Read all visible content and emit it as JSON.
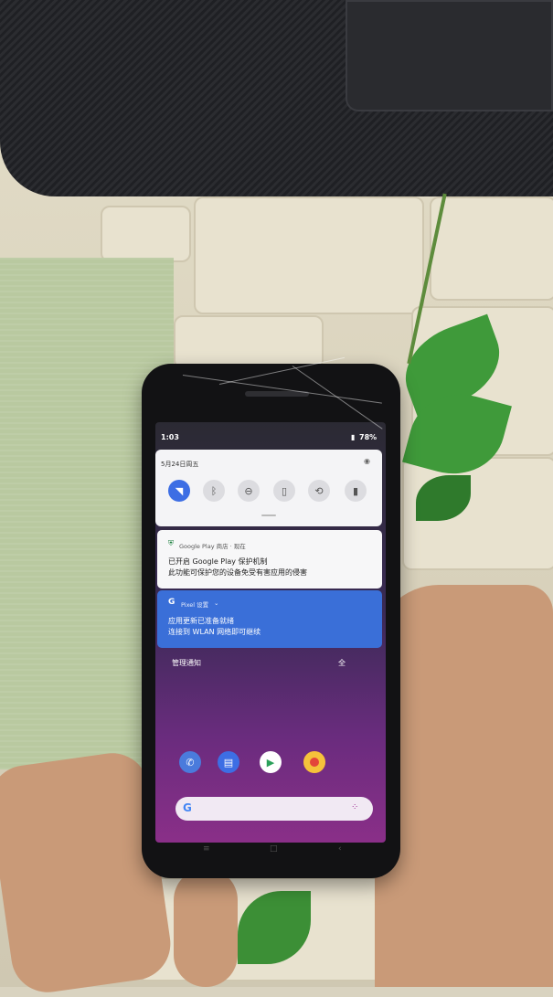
{
  "status_bar": {
    "time": "1:03",
    "battery": "78%"
  },
  "quick_settings": {
    "date": "5月24日周五",
    "tiles": [
      {
        "icon": "wifi-icon",
        "on": true
      },
      {
        "icon": "bluetooth-icon",
        "on": false
      },
      {
        "icon": "do-not-disturb-icon",
        "on": false
      },
      {
        "icon": "flashlight-icon",
        "on": false
      },
      {
        "icon": "auto-rotate-icon",
        "on": false
      },
      {
        "icon": "battery-saver-icon",
        "on": false
      }
    ]
  },
  "notifications": [
    {
      "app": "Google Play 商店 · 现在",
      "line1": "已开启 Google Play 保护机制",
      "line2": "此功能可保护您的设备免受有害应用的侵害"
    },
    {
      "app": "Pixel 设置",
      "line1": "应用更新已准备就绪",
      "line2": "连接到 WLAN 网络即可继续"
    }
  ],
  "actions": {
    "manage": "管理通知",
    "clear_all": "全"
  },
  "dock": [
    {
      "icon": "phone-icon",
      "color": "#4a7bdc"
    },
    {
      "icon": "messages-icon",
      "color": "#3d6ee4"
    },
    {
      "icon": "play-store-icon",
      "color": "#ffffff"
    },
    {
      "icon": "chrome-icon",
      "color": "#e3453a"
    }
  ],
  "search": {
    "logo": "G"
  }
}
